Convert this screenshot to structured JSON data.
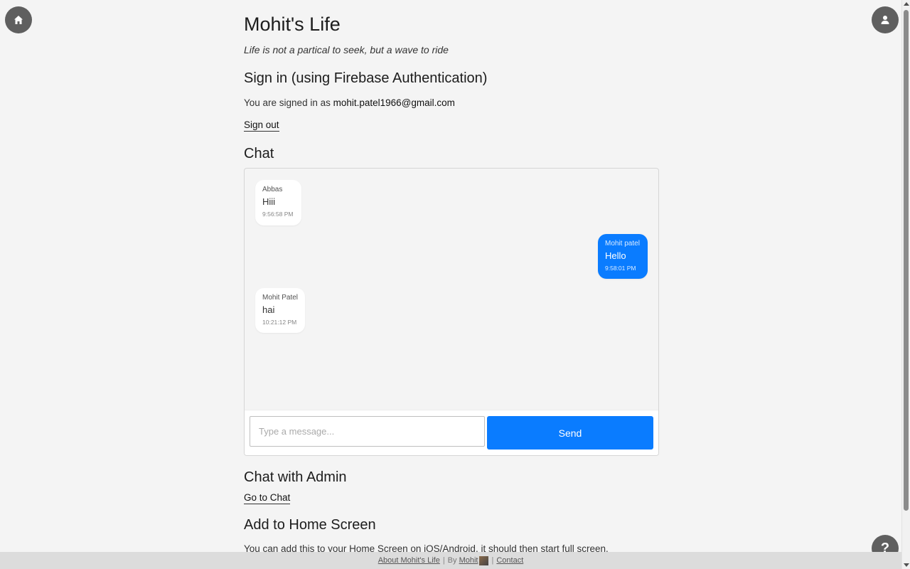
{
  "site": {
    "title": "Mohit's Life",
    "tagline": "Life is not a partical to seek, but a wave to ride"
  },
  "signin": {
    "heading": "Sign in (using Firebase Authentication)",
    "status_prefix": "You are signed in as",
    "email": "mohit.patel1966@gmail.com",
    "signout_label": "Sign out"
  },
  "chat": {
    "heading": "Chat",
    "messages": [
      {
        "sender": "Abbas",
        "text": "Hiii",
        "time": "9:56:58 PM",
        "direction": "incoming"
      },
      {
        "sender": "Mohit patel",
        "text": "Hello",
        "time": "9:58:01 PM",
        "direction": "outgoing"
      },
      {
        "sender": "Mohit Patel",
        "text": "hai",
        "time": "10:21:12 PM",
        "direction": "incoming"
      }
    ],
    "input_placeholder": "Type a message...",
    "input_value": "",
    "send_label": "Send",
    "accent_color": "#0a7cff"
  },
  "admin": {
    "heading": "Chat with Admin",
    "link_label": "Go to Chat"
  },
  "home_screen": {
    "heading": "Add to Home Screen",
    "text": "You can add this to your Home Screen on iOS/Android, it should then start full screen."
  },
  "footer": {
    "about_label": "About Mohit's Life",
    "by_label": "By",
    "author_label": "Mohit",
    "contact_label": "Contact"
  },
  "floating_buttons": {
    "home_icon": "home-icon",
    "user_icon": "user-icon",
    "help_label": "?"
  }
}
